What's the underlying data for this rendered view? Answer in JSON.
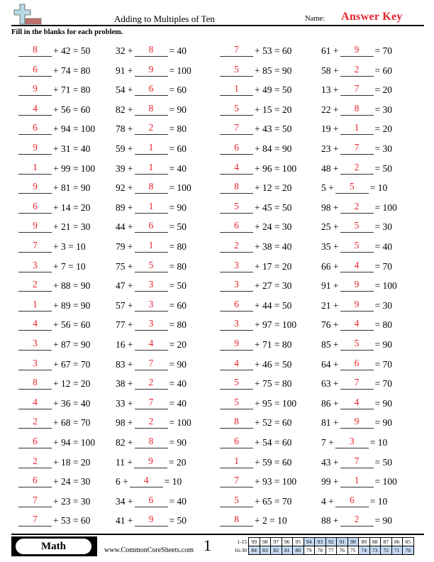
{
  "header": {
    "title": "Adding to Multiples of Ten",
    "name_label": "Name:",
    "name_value": "Answer Key",
    "instructions": "Fill in the blanks for each problem.",
    "logo_icon": "plus-ruler-logo-icon"
  },
  "colors": {
    "answer": "#e8232b",
    "logo_plus": "#b7dbe6",
    "logo_bar": "#c0706d",
    "key_highlight": "#c5d9f1"
  },
  "problems": {
    "col1": [
      {
        "answer": "8",
        "text": "+ 42 = 50"
      },
      {
        "answer": "6",
        "text": "+ 74 = 80"
      },
      {
        "answer": "9",
        "text": "+ 71 = 80"
      },
      {
        "answer": "4",
        "text": "+ 56 = 60"
      },
      {
        "answer": "6",
        "text": "+ 94 = 100"
      },
      {
        "answer": "9",
        "text": "+ 31 = 40"
      },
      {
        "answer": "1",
        "text": "+ 99 = 100"
      },
      {
        "answer": "9",
        "text": "+ 81 = 90"
      },
      {
        "answer": "6",
        "text": "+ 14 = 20"
      },
      {
        "answer": "9",
        "text": "+ 21 = 30"
      },
      {
        "answer": "7",
        "text": "+ 3 = 10"
      },
      {
        "answer": "3",
        "text": "+ 7 = 10"
      },
      {
        "answer": "2",
        "text": "+ 88 = 90"
      },
      {
        "answer": "1",
        "text": "+ 89 = 90"
      },
      {
        "answer": "4",
        "text": "+ 56 = 60"
      },
      {
        "answer": "3",
        "text": "+ 87 = 90"
      },
      {
        "answer": "3",
        "text": "+ 67 = 70"
      },
      {
        "answer": "8",
        "text": "+ 12 = 20"
      },
      {
        "answer": "4",
        "text": "+ 36 = 40"
      },
      {
        "answer": "2",
        "text": "+ 68 = 70"
      },
      {
        "answer": "6",
        "text": "+ 94 = 100"
      },
      {
        "answer": "2",
        "text": "+ 18 = 20"
      },
      {
        "answer": "6",
        "text": "+ 24 = 30"
      },
      {
        "answer": "7",
        "text": "+ 23 = 30"
      },
      {
        "answer": "7",
        "text": "+ 53 = 60"
      }
    ],
    "col2": [
      {
        "pre": "32 +",
        "answer": "8",
        "post": "= 40"
      },
      {
        "pre": "91 +",
        "answer": "9",
        "post": "= 100"
      },
      {
        "pre": "54 +",
        "answer": "6",
        "post": "= 60"
      },
      {
        "pre": "82 +",
        "answer": "8",
        "post": "= 90"
      },
      {
        "pre": "78 +",
        "answer": "2",
        "post": "= 80"
      },
      {
        "pre": "59 +",
        "answer": "1",
        "post": "= 60"
      },
      {
        "pre": "39 +",
        "answer": "1",
        "post": "= 40"
      },
      {
        "pre": "92 +",
        "answer": "8",
        "post": "= 100"
      },
      {
        "pre": "89 +",
        "answer": "1",
        "post": "= 90"
      },
      {
        "pre": "44 +",
        "answer": "6",
        "post": "= 50"
      },
      {
        "pre": "79 +",
        "answer": "1",
        "post": "= 80"
      },
      {
        "pre": "75 +",
        "answer": "5",
        "post": "= 80"
      },
      {
        "pre": "47 +",
        "answer": "3",
        "post": "= 50"
      },
      {
        "pre": "57 +",
        "answer": "3",
        "post": "= 60"
      },
      {
        "pre": "77 +",
        "answer": "3",
        "post": "= 80"
      },
      {
        "pre": "16 +",
        "answer": "4",
        "post": "= 20"
      },
      {
        "pre": "83 +",
        "answer": "7",
        "post": "= 90"
      },
      {
        "pre": "38 +",
        "answer": "2",
        "post": "= 40"
      },
      {
        "pre": "33 +",
        "answer": "7",
        "post": "= 40"
      },
      {
        "pre": "98 +",
        "answer": "2",
        "post": "= 100"
      },
      {
        "pre": "82 +",
        "answer": "8",
        "post": "= 90"
      },
      {
        "pre": "11 +",
        "answer": "9",
        "post": "= 20"
      },
      {
        "pre": "6 +",
        "answer": "4",
        "post": "= 10"
      },
      {
        "pre": "34 +",
        "answer": "6",
        "post": "= 40"
      },
      {
        "pre": "41 +",
        "answer": "9",
        "post": "= 50"
      }
    ],
    "col3": [
      {
        "answer": "7",
        "text": "+ 53 = 60"
      },
      {
        "answer": "5",
        "text": "+ 85 = 90"
      },
      {
        "answer": "1",
        "text": "+ 49 = 50"
      },
      {
        "answer": "5",
        "text": "+ 15 = 20"
      },
      {
        "answer": "7",
        "text": "+ 43 = 50"
      },
      {
        "answer": "6",
        "text": "+ 84 = 90"
      },
      {
        "answer": "4",
        "text": "+ 96 = 100"
      },
      {
        "answer": "8",
        "text": "+ 12 = 20"
      },
      {
        "answer": "5",
        "text": "+ 45 = 50"
      },
      {
        "answer": "6",
        "text": "+ 24 = 30"
      },
      {
        "answer": "2",
        "text": "+ 38 = 40"
      },
      {
        "answer": "3",
        "text": "+ 17 = 20"
      },
      {
        "answer": "3",
        "text": "+ 27 = 30"
      },
      {
        "answer": "6",
        "text": "+ 44 = 50"
      },
      {
        "answer": "3",
        "text": "+ 97 = 100"
      },
      {
        "answer": "9",
        "text": "+ 71 = 80"
      },
      {
        "answer": "4",
        "text": "+ 46 = 50"
      },
      {
        "answer": "5",
        "text": "+ 75 = 80"
      },
      {
        "answer": "5",
        "text": "+ 95 = 100"
      },
      {
        "answer": "8",
        "text": "+ 52 = 60"
      },
      {
        "answer": "6",
        "text": "+ 54 = 60"
      },
      {
        "answer": "1",
        "text": "+ 59 = 60"
      },
      {
        "answer": "7",
        "text": "+ 93 = 100"
      },
      {
        "answer": "5",
        "text": "+ 65 = 70"
      },
      {
        "answer": "8",
        "text": "+ 2 = 10"
      }
    ],
    "col4": [
      {
        "pre": "61 +",
        "answer": "9",
        "post": "= 70"
      },
      {
        "pre": "58 +",
        "answer": "2",
        "post": "= 60"
      },
      {
        "pre": "13 +",
        "answer": "7",
        "post": "= 20"
      },
      {
        "pre": "22 +",
        "answer": "8",
        "post": "= 30"
      },
      {
        "pre": "19 +",
        "answer": "1",
        "post": "= 20"
      },
      {
        "pre": "23 +",
        "answer": "7",
        "post": "= 30"
      },
      {
        "pre": "48 +",
        "answer": "2",
        "post": "= 50"
      },
      {
        "pre": "5 +",
        "answer": "5",
        "post": "= 10"
      },
      {
        "pre": "98 +",
        "answer": "2",
        "post": "= 100"
      },
      {
        "pre": "25 +",
        "answer": "5",
        "post": "= 30"
      },
      {
        "pre": "35 +",
        "answer": "5",
        "post": "= 40"
      },
      {
        "pre": "66 +",
        "answer": "4",
        "post": "= 70"
      },
      {
        "pre": "91 +",
        "answer": "9",
        "post": "= 100"
      },
      {
        "pre": "21 +",
        "answer": "9",
        "post": "= 30"
      },
      {
        "pre": "76 +",
        "answer": "4",
        "post": "= 80"
      },
      {
        "pre": "85 +",
        "answer": "5",
        "post": "= 90"
      },
      {
        "pre": "64 +",
        "answer": "6",
        "post": "= 70"
      },
      {
        "pre": "63 +",
        "answer": "7",
        "post": "= 70"
      },
      {
        "pre": "86 +",
        "answer": "4",
        "post": "= 90"
      },
      {
        "pre": "81 +",
        "answer": "9",
        "post": "= 90"
      },
      {
        "pre": "7 +",
        "answer": "3",
        "post": "= 10"
      },
      {
        "pre": "43 +",
        "answer": "7",
        "post": "= 50"
      },
      {
        "pre": "99 +",
        "answer": "1",
        "post": "= 100"
      },
      {
        "pre": "4 +",
        "answer": "6",
        "post": "= 10"
      },
      {
        "pre": "88 +",
        "answer": "2",
        "post": "= 90"
      }
    ]
  },
  "footer": {
    "subject": "Math",
    "website": "www.CommonCoreSheets.com",
    "page_number": "1",
    "score_rows": [
      {
        "label": "1-15",
        "cells": [
          "99",
          "98",
          "97",
          "96",
          "95",
          "94",
          "93",
          "92",
          "91",
          "90",
          "89",
          "88",
          "87",
          "86",
          "85"
        ],
        "highlight": [
          false,
          false,
          false,
          false,
          false,
          true,
          true,
          true,
          true,
          true,
          false,
          false,
          false,
          false,
          false
        ]
      },
      {
        "label": "16-30",
        "cells": [
          "84",
          "83",
          "82",
          "81",
          "80",
          "79",
          "78",
          "77",
          "76",
          "75",
          "74",
          "73",
          "72",
          "71",
          "70"
        ],
        "highlight": [
          true,
          true,
          true,
          true,
          true,
          false,
          false,
          false,
          false,
          false,
          true,
          true,
          true,
          true,
          true
        ]
      }
    ]
  }
}
